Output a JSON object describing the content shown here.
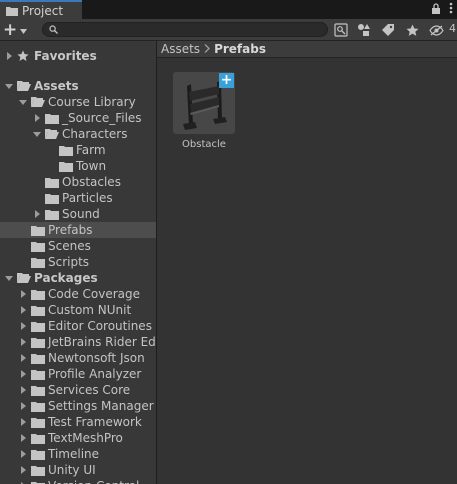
{
  "window": {
    "tab_title": "Project",
    "hidden_count": "4"
  },
  "toolbar": {
    "add_label": "+",
    "search_value": "",
    "search_placeholder": ""
  },
  "tree": [
    {
      "label": "Favorites",
      "icon": "star-icon",
      "arrow": "collapsed",
      "bold": true
    },
    {
      "label": "Assets",
      "icon": "folder-open-icon",
      "arrow": "expanded",
      "bold": true
    },
    {
      "label": "Course Library",
      "icon": "folder-open-icon",
      "arrow": "expanded"
    },
    {
      "label": "_Source_Files",
      "icon": "folder-icon",
      "arrow": "collapsed"
    },
    {
      "label": "Characters",
      "icon": "folder-open-icon",
      "arrow": "expanded"
    },
    {
      "label": "Farm",
      "icon": "folder-icon",
      "arrow": "none"
    },
    {
      "label": "Town",
      "icon": "folder-icon",
      "arrow": "none"
    },
    {
      "label": "Obstacles",
      "icon": "folder-icon",
      "arrow": "none"
    },
    {
      "label": "Particles",
      "icon": "folder-icon",
      "arrow": "none"
    },
    {
      "label": "Sound",
      "icon": "folder-icon",
      "arrow": "collapsed"
    },
    {
      "label": "Prefabs",
      "icon": "folder-icon",
      "arrow": "none",
      "selected": true
    },
    {
      "label": "Scenes",
      "icon": "folder-icon",
      "arrow": "none"
    },
    {
      "label": "Scripts",
      "icon": "folder-icon",
      "arrow": "none"
    },
    {
      "label": "Packages",
      "icon": "folder-open-icon",
      "arrow": "expanded",
      "bold": true
    },
    {
      "label": "Code Coverage",
      "icon": "folder-icon",
      "arrow": "collapsed"
    },
    {
      "label": "Custom NUnit",
      "icon": "folder-icon",
      "arrow": "collapsed"
    },
    {
      "label": "Editor Coroutines",
      "icon": "folder-icon",
      "arrow": "collapsed"
    },
    {
      "label": "JetBrains Rider Edit",
      "icon": "folder-icon",
      "arrow": "collapsed"
    },
    {
      "label": "Newtonsoft Json",
      "icon": "folder-icon",
      "arrow": "collapsed"
    },
    {
      "label": "Profile Analyzer",
      "icon": "folder-icon",
      "arrow": "collapsed"
    },
    {
      "label": "Services Core",
      "icon": "folder-icon",
      "arrow": "collapsed"
    },
    {
      "label": "Settings Manager",
      "icon": "folder-icon",
      "arrow": "collapsed"
    },
    {
      "label": "Test Framework",
      "icon": "folder-icon",
      "arrow": "collapsed"
    },
    {
      "label": "TextMeshPro",
      "icon": "folder-icon",
      "arrow": "collapsed"
    },
    {
      "label": "Timeline",
      "icon": "folder-icon",
      "arrow": "collapsed"
    },
    {
      "label": "Unity UI",
      "icon": "folder-icon",
      "arrow": "collapsed"
    },
    {
      "label": "Version Control",
      "icon": "folder-icon",
      "arrow": "collapsed"
    }
  ],
  "breadcrumb": [
    {
      "label": "Assets",
      "current": false
    },
    {
      "label": "Prefabs",
      "current": true
    }
  ],
  "assets": [
    {
      "name": "Obstacle",
      "type": "prefab"
    }
  ],
  "colors": {
    "accent": "#3a79bb",
    "prefab_badge": "#3aa0d8",
    "selection": "#4d4d4d"
  }
}
